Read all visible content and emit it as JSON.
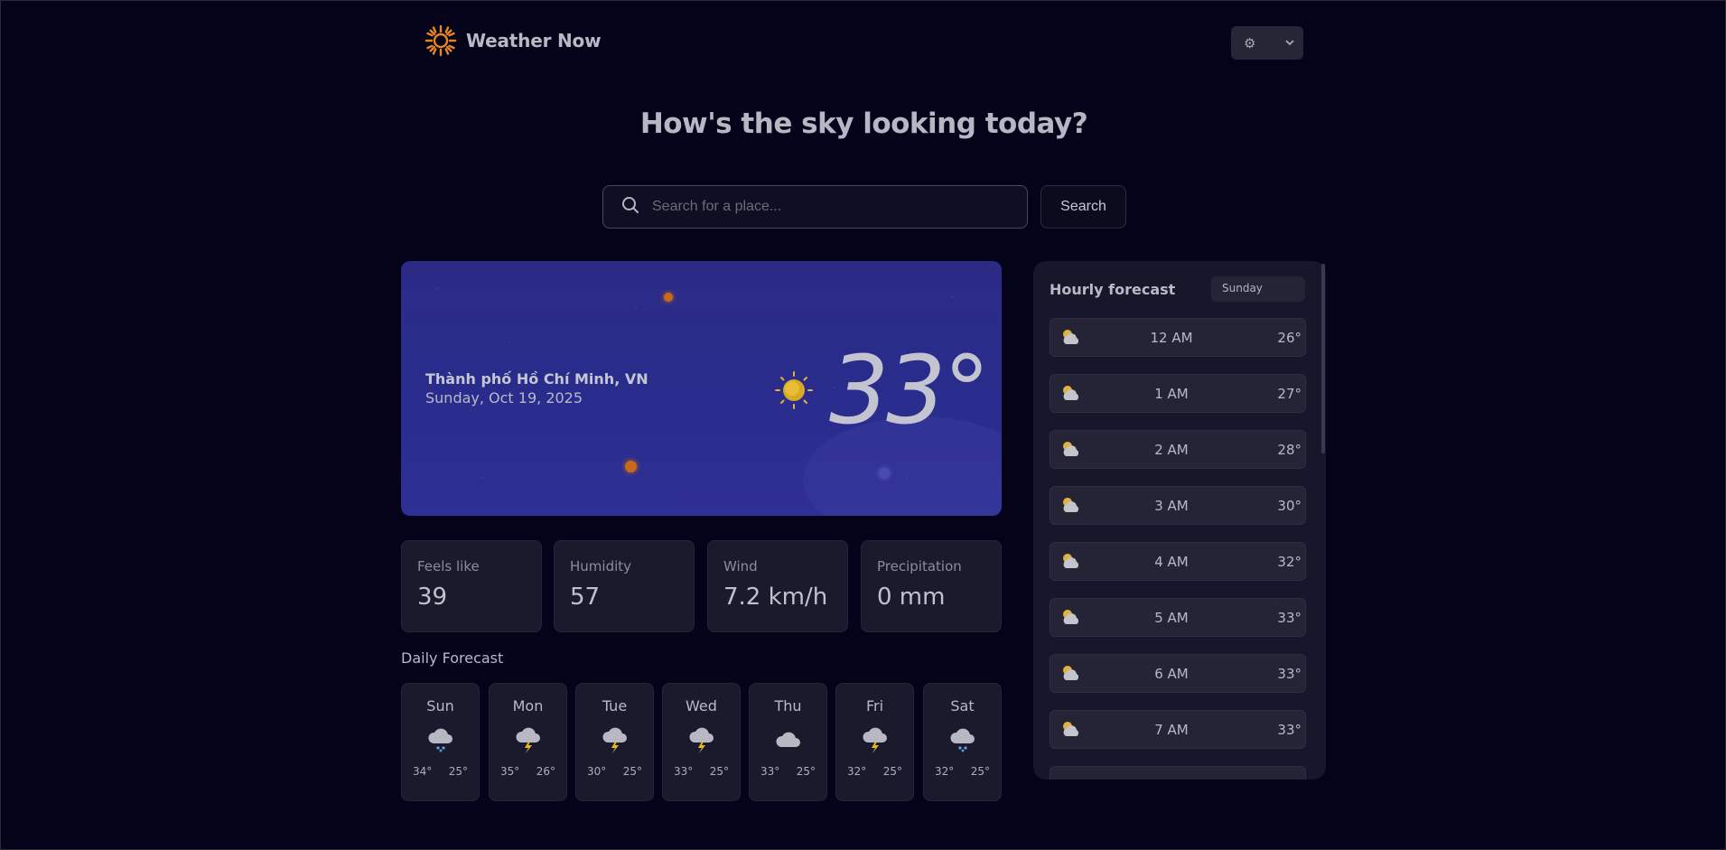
{
  "app": {
    "title": "Weather Now"
  },
  "header": {
    "units_icon": "gear-icon"
  },
  "hero": {
    "title": "How's the sky looking today?"
  },
  "search": {
    "placeholder": "Search for a place...",
    "button_label": "Search"
  },
  "current": {
    "location": "Thành phố Hồ Chí Minh, VN",
    "date": "Sunday, Oct 19, 2025",
    "temperature": "33°",
    "icon": "sun-icon"
  },
  "metrics": [
    {
      "label": "Feels like",
      "value": "39"
    },
    {
      "label": "Humidity",
      "value": "57"
    },
    {
      "label": "Wind",
      "value": "7.2 km/h"
    },
    {
      "label": "Precipitation",
      "value": "0 mm"
    }
  ],
  "daily": {
    "title": "Daily Forecast",
    "days": [
      {
        "name": "Sun",
        "high": "34°",
        "low": "25°",
        "icon": "snow-cloud-icon"
      },
      {
        "name": "Mon",
        "high": "35°",
        "low": "26°",
        "icon": "storm-icon"
      },
      {
        "name": "Tue",
        "high": "30°",
        "low": "25°",
        "icon": "storm-icon"
      },
      {
        "name": "Wed",
        "high": "33°",
        "low": "25°",
        "icon": "storm-icon"
      },
      {
        "name": "Thu",
        "high": "33°",
        "low": "25°",
        "icon": "cloud-icon"
      },
      {
        "name": "Fri",
        "high": "32°",
        "low": "25°",
        "icon": "storm-icon"
      },
      {
        "name": "Sat",
        "high": "32°",
        "low": "25°",
        "icon": "snow-cloud-icon"
      }
    ]
  },
  "hourly": {
    "title": "Hourly forecast",
    "selected_day": "Sunday",
    "hours": [
      {
        "time": "12 AM",
        "temp": "26°",
        "icon": "partly-cloudy-icon"
      },
      {
        "time": "1 AM",
        "temp": "27°",
        "icon": "partly-cloudy-icon"
      },
      {
        "time": "2 AM",
        "temp": "28°",
        "icon": "partly-cloudy-icon"
      },
      {
        "time": "3 AM",
        "temp": "30°",
        "icon": "partly-cloudy-icon"
      },
      {
        "time": "4 AM",
        "temp": "32°",
        "icon": "partly-cloudy-icon"
      },
      {
        "time": "5 AM",
        "temp": "33°",
        "icon": "partly-cloudy-icon"
      },
      {
        "time": "6 AM",
        "temp": "33°",
        "icon": "partly-cloudy-icon"
      },
      {
        "time": "7 AM",
        "temp": "33°",
        "icon": "partly-cloudy-icon"
      }
    ]
  },
  "colors": {
    "background": "#04031a",
    "card": "#1b1a2d",
    "hero_card": "#2b2b86",
    "accent_orange": "#e8871e"
  }
}
